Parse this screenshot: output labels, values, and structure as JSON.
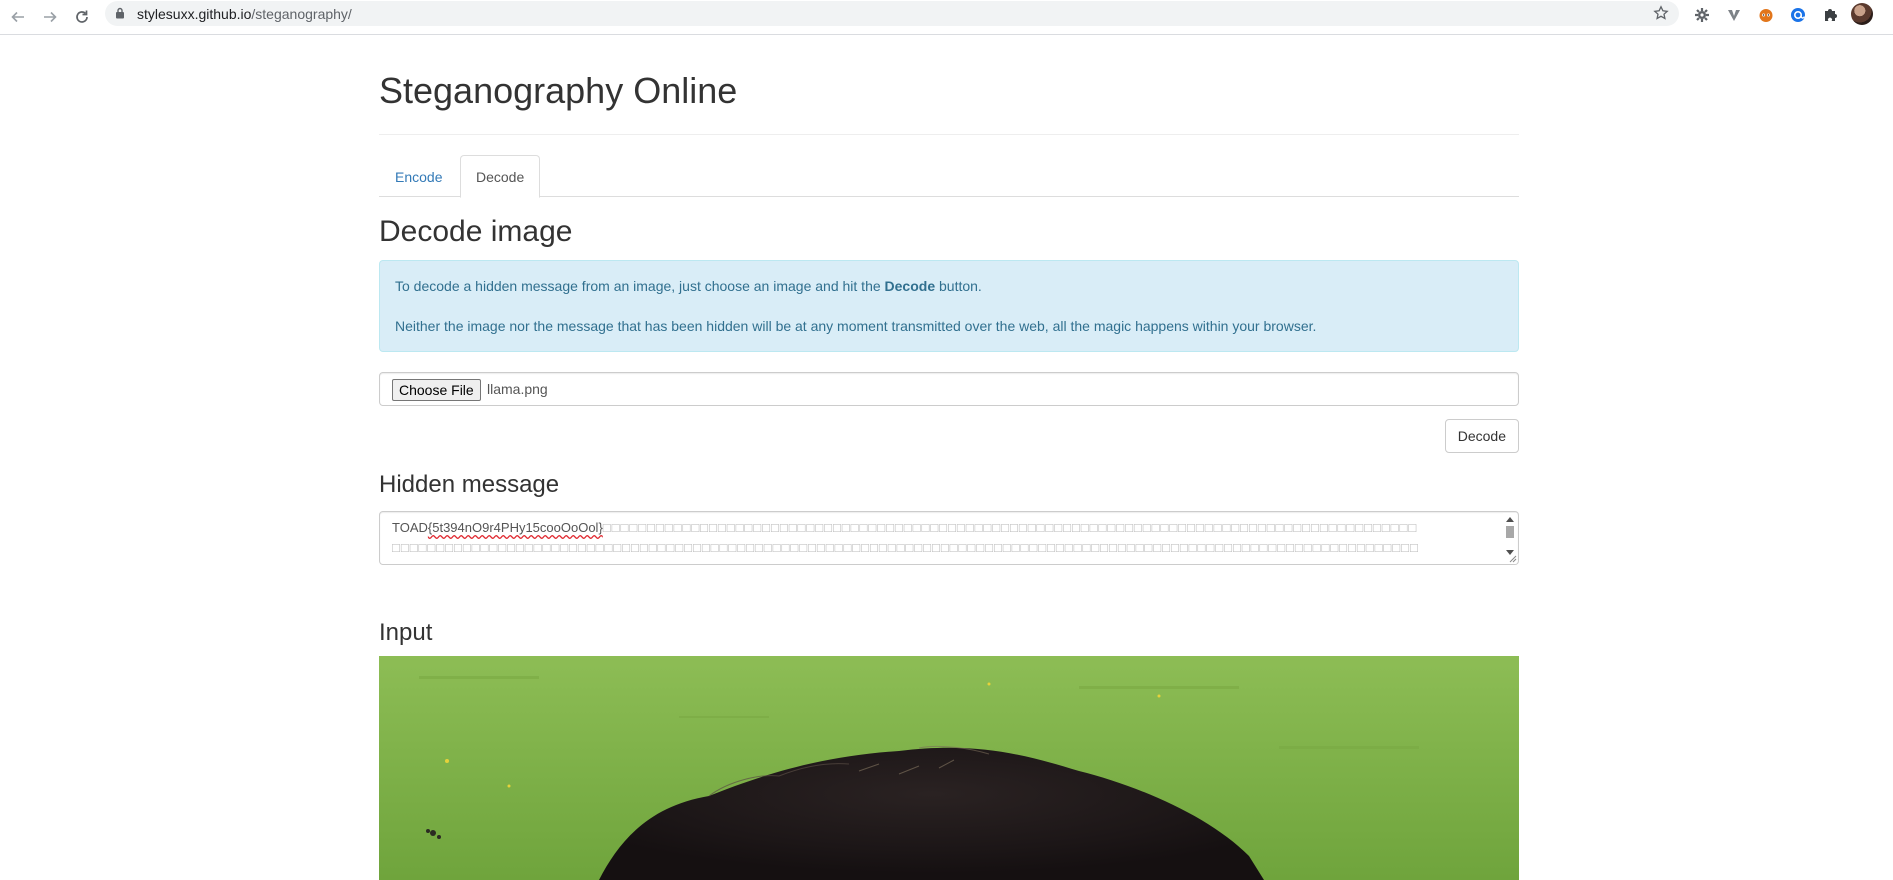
{
  "browser": {
    "url_host": "stylesuxx.github.io",
    "url_path": "/steganography/"
  },
  "page": {
    "title": "Steganography Online"
  },
  "tabs": [
    {
      "label": "Encode",
      "active": false
    },
    {
      "label": "Decode",
      "active": true
    }
  ],
  "decode": {
    "heading": "Decode image",
    "info_line1_before": "To decode a hidden message from an image, just choose an image and hit the ",
    "info_line1_bold": "Decode",
    "info_line1_after": " button.",
    "info_line2": "Neither the image nor the message that has been hidden will be at any moment transmitted over the web, all the magic happens within your browser.",
    "choose_file_label": "Choose File",
    "file_name": "llama.png",
    "decode_button_label": "Decode"
  },
  "hidden_message": {
    "heading": "Hidden message",
    "prefix": "TOAD",
    "flag": "{5t394nO9r4PHy15cooOoOol}",
    "line1_boxes": "□□□□□□□□□□□□□□□□□□□□□□□□□□□□□□□□□□□□□□□□□□□□□□□□□□□□□□□□□□□□□□□□□□□□□□□□□□□□□□□□□□□□□□□□□□□□",
    "line2_boxes": "□□□□□□□□□□□□□□□□□□□□□□□□□□□□□□□□□□□□□□□□□□□□□□□□□□□□□□□□□□□□□□□□□□□□□□□□□□□□□□□□□□□□□□□□□□□□□□□□□□□□□□□□□□□□□□□□□□□□"
  },
  "input": {
    "heading": "Input"
  },
  "colors": {
    "link": "#337ab7",
    "alert_bg": "#d9edf7",
    "alert_text": "#31708f",
    "grass": "#7fb24a"
  }
}
